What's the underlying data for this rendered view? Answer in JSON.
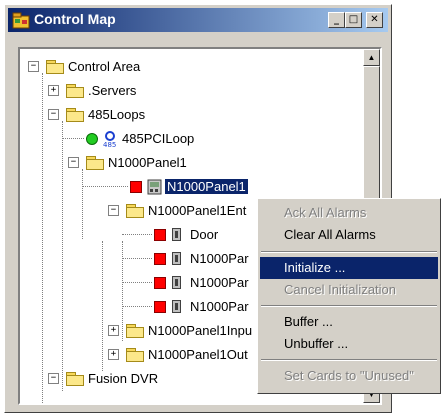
{
  "window": {
    "title": "Control Map",
    "controls": {
      "minimize": "_",
      "maximize": "□",
      "close": "✕"
    }
  },
  "tree": {
    "nodes": [
      {
        "label": "Control Area",
        "icon": "folder-icon",
        "expander": "−"
      },
      {
        "label": ".Servers",
        "icon": "folder-icon",
        "expander": "+"
      },
      {
        "label": "485Loops",
        "icon": "folder-icon",
        "expander": "−"
      },
      {
        "label": "485PCILoop",
        "icon": "loop-icon",
        "status": "green"
      },
      {
        "label": "N1000Panel1",
        "icon": "folder-icon",
        "expander": "−"
      },
      {
        "label": "N1000Panel1",
        "icon": "panel-icon",
        "status": "red",
        "selected": true
      },
      {
        "label": "N1000Panel1Ent",
        "icon": "folder-icon",
        "expander": "−"
      },
      {
        "label": "Door",
        "icon": "device-icon",
        "status": "red"
      },
      {
        "label": "N1000Par",
        "icon": "device-icon",
        "status": "red"
      },
      {
        "label": "N1000Par",
        "icon": "device-icon",
        "status": "red"
      },
      {
        "label": "N1000Par",
        "icon": "device-icon",
        "status": "red"
      },
      {
        "label": "N1000Panel1Inpu",
        "icon": "folder-icon",
        "expander": "+"
      },
      {
        "label": "N1000Panel1Out",
        "icon": "folder-icon",
        "expander": "+"
      },
      {
        "label": "Fusion DVR",
        "icon": "folder-icon",
        "expander": "−"
      }
    ]
  },
  "context_menu": {
    "items": [
      {
        "label": "Ack All Alarms",
        "enabled": false
      },
      {
        "label": "Clear All Alarms",
        "enabled": true
      },
      {
        "label": "Initialize ...",
        "enabled": true,
        "highlighted": true
      },
      {
        "label": "Cancel Initialization",
        "enabled": false
      },
      {
        "label": "Buffer ...",
        "enabled": true
      },
      {
        "label": "Unbuffer ...",
        "enabled": true
      },
      {
        "label": "Set Cards to \"Unused\"",
        "enabled": false
      }
    ]
  },
  "colors": {
    "titlebar": "#0a246a",
    "highlight": "#0a246a",
    "status_red": "#ff0000",
    "status_green": "#22cc22"
  }
}
